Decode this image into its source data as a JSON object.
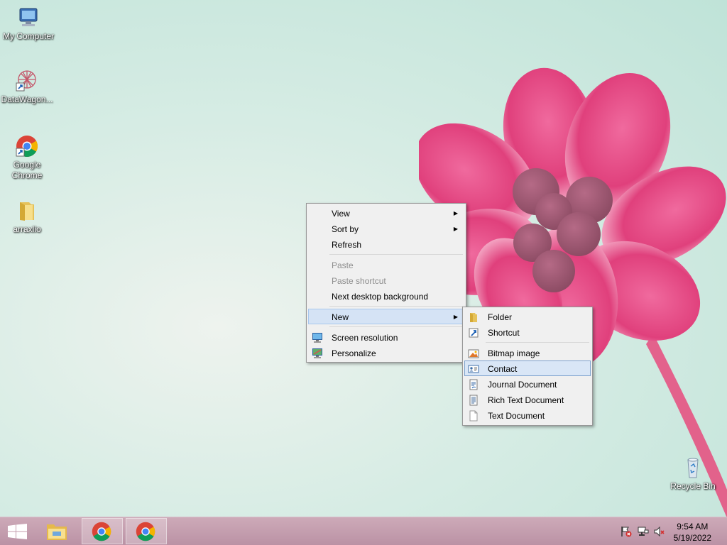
{
  "desktop": {
    "icons": [
      {
        "label": "My Computer"
      },
      {
        "label": "DataWagon..."
      },
      {
        "label": "Google Chrome"
      },
      {
        "label": "arraxlio"
      },
      {
        "label": "Recycle Bin"
      }
    ]
  },
  "context_menu": {
    "items": [
      {
        "label": "View",
        "submenu": true
      },
      {
        "label": "Sort by",
        "submenu": true
      },
      {
        "label": "Refresh"
      },
      {
        "label": "Paste",
        "disabled": true
      },
      {
        "label": "Paste shortcut",
        "disabled": true
      },
      {
        "label": "Next desktop background"
      },
      {
        "label": "New",
        "submenu": true,
        "highlighted": true
      },
      {
        "label": "Screen resolution",
        "icon": "screen-resolution-icon"
      },
      {
        "label": "Personalize",
        "icon": "personalize-icon"
      }
    ]
  },
  "new_submenu": {
    "items": [
      {
        "label": "Folder",
        "icon": "folder-icon"
      },
      {
        "label": "Shortcut",
        "icon": "shortcut-icon"
      },
      {
        "label": "Bitmap image",
        "icon": "bitmap-icon"
      },
      {
        "label": "Contact",
        "icon": "contact-icon",
        "highlighted": true
      },
      {
        "label": "Journal Document",
        "icon": "journal-icon"
      },
      {
        "label": "Rich Text Document",
        "icon": "rich-text-icon"
      },
      {
        "label": "Text Document",
        "icon": "text-document-icon"
      }
    ]
  },
  "taskbar": {
    "buttons": [
      {
        "name": "start-button",
        "icon": "windows-logo-icon"
      },
      {
        "name": "file-explorer-button",
        "icon": "file-explorer-icon"
      },
      {
        "name": "chrome-button-1",
        "icon": "chrome-icon",
        "active": true
      },
      {
        "name": "chrome-button-2",
        "icon": "chrome-icon",
        "active": true
      }
    ],
    "tray_icons": [
      "action-center-flag-icon",
      "network-icon",
      "volume-muted-icon"
    ],
    "clock": {
      "time": "9:54 AM",
      "date": "5/19/2022"
    }
  },
  "colors": {
    "menu_highlight": "#d5e3f5",
    "taskbar": "#c49eb0",
    "flower": "#e0457f"
  }
}
